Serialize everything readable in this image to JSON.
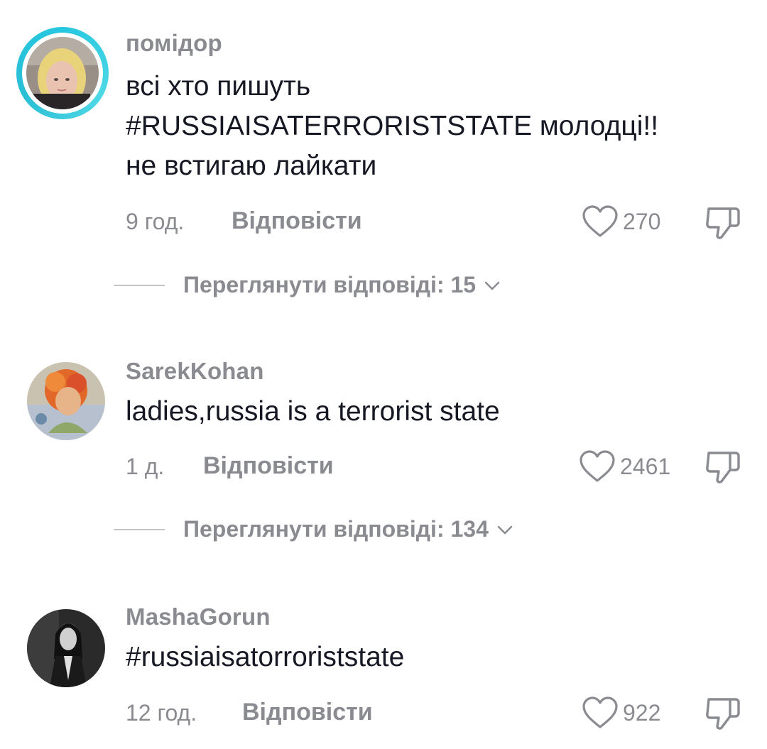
{
  "comments": [
    {
      "username": "помідор",
      "text_lines": [
        "всі хто пишуть",
        "#RUSSIAISATERRORISTSTATE молодці!!",
        "не встигаю лайкати"
      ],
      "time": "9 год.",
      "reply_label": "Відповісти",
      "likes": "270",
      "view_replies": "Переглянути відповіді: 15"
    },
    {
      "username": "SarekKohan",
      "text_lines": [
        "ladies,russia is a terrorist state"
      ],
      "time": "1 д.",
      "reply_label": "Відповісти",
      "likes": "2461",
      "view_replies": "Переглянути відповіді: 134"
    },
    {
      "username": "MashaGorun",
      "text_lines": [
        "#russiaisatorroriststate"
      ],
      "time": "12 год.",
      "reply_label": "Відповісти",
      "likes": "922"
    }
  ],
  "icons": {
    "like": "heart-outline-icon",
    "dislike": "thumbs-down-outline-icon",
    "expand": "chevron-down-icon"
  },
  "colors": {
    "text_primary": "#161823",
    "text_secondary": "#8a8b91",
    "story_ring": "#25c7df"
  }
}
